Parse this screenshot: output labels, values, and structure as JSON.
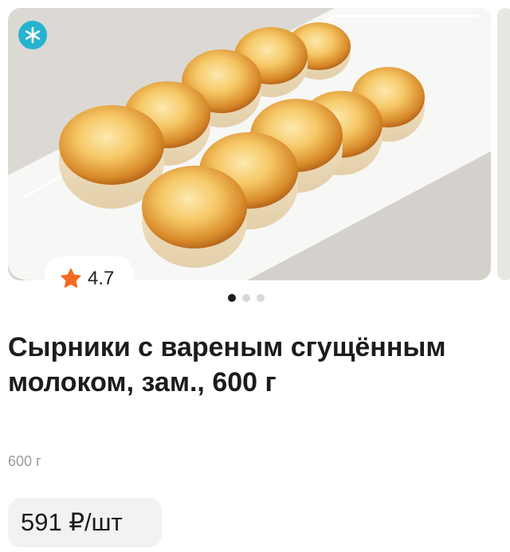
{
  "product": {
    "image_alt": "Сырники",
    "rating": "4.7",
    "title": "Сырники с вареным сгущённым молоком, зам., 600 г",
    "weight": "600 г",
    "price": "591 ₽/шт"
  },
  "gallery": {
    "dot_count": 3,
    "active_index": 0
  },
  "icons": {
    "badge": "snowflake-icon",
    "rating": "star-icon"
  },
  "colors": {
    "badge": "#27b3cf",
    "star": "#f26a1f",
    "price_bg": "#f2f2f2",
    "weight_text": "#9a9a9a"
  }
}
